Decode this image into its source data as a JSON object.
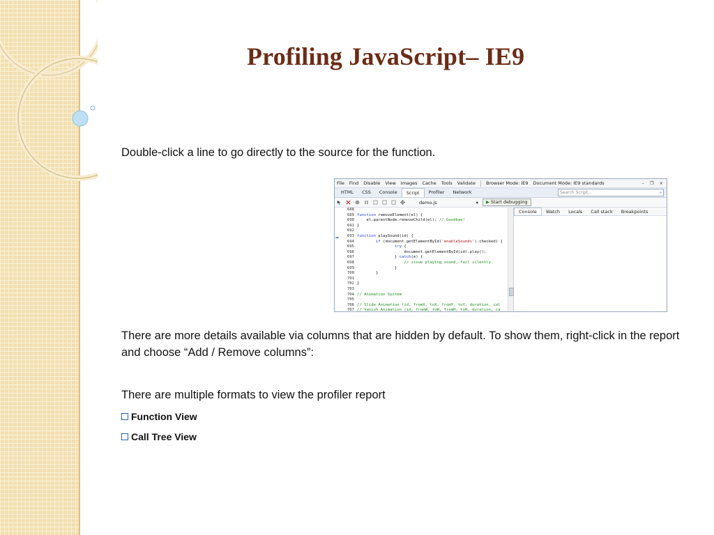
{
  "slide": {
    "title": "Profiling JavaScript– IE9",
    "paragraph1": "Double-click a line to go directly to the source for the function.",
    "paragraph2": "There are more details available via columns that are hidden by default.  To show them, right-click in the report and choose “Add / Remove columns”:",
    "paragraph3": "There are multiple formats to view the profiler report",
    "bullets": [
      "Function View",
      "Call Tree View"
    ]
  },
  "devtools": {
    "menu": [
      "File",
      "Find",
      "Disable",
      "View",
      "Images",
      "Cache",
      "Tools",
      "Validate"
    ],
    "browser_mode": "Browser Mode: IE9",
    "document_mode": "Document Mode: IE9 standards",
    "window_buttons": [
      "–",
      "❐",
      "×"
    ],
    "tabs": [
      "HTML",
      "CSS",
      "Console",
      "Script",
      "Profiler",
      "Network"
    ],
    "active_tab": "Script",
    "search_placeholder": "Search Script...",
    "file": "demo.js",
    "start_debugging": "Start debugging",
    "right_tabs": [
      "Console",
      "Watch",
      "Locals",
      "Call stack",
      "Breakpoints"
    ],
    "code": [
      {
        "n": "688",
        "t": ""
      },
      {
        "n": "689",
        "t": "function removeElement(el) {"
      },
      {
        "n": "690",
        "t": "    el.parentNode.removeChild(el); // Goodbye!"
      },
      {
        "n": "691",
        "t": "}"
      },
      {
        "n": "692",
        "t": ""
      },
      {
        "n": "693",
        "t": "function playSound(id) {"
      },
      {
        "n": "694",
        "t": "        if (document.getElementById('enableSounds').checked) {"
      },
      {
        "n": "695",
        "t": "                try {"
      },
      {
        "n": "696",
        "t": "                    document.getElementById(id).play();"
      },
      {
        "n": "697",
        "t": "                } catch(e) {"
      },
      {
        "n": "698",
        "t": "                    // issue playing sound, fail silently."
      },
      {
        "n": "699",
        "t": "                }"
      },
      {
        "n": "700",
        "t": "        }"
      },
      {
        "n": "701",
        "t": ""
      },
      {
        "n": "702",
        "t": "}"
      },
      {
        "n": "703",
        "t": ""
      },
      {
        "n": "704",
        "t": "// Animation System"
      },
      {
        "n": "705",
        "t": ""
      },
      {
        "n": "706",
        "t": "// Slide Animation (id, fromX, toX, fromY, toY, duration, cal"
      },
      {
        "n": "707",
        "t": "// Vanish Animation (id, fromW, toW, fromH, toH, duration, ca"
      }
    ]
  },
  "colors": {
    "title": "#6b2c16",
    "strip": "#f2dfb0",
    "accent": "#2b5fa8"
  }
}
